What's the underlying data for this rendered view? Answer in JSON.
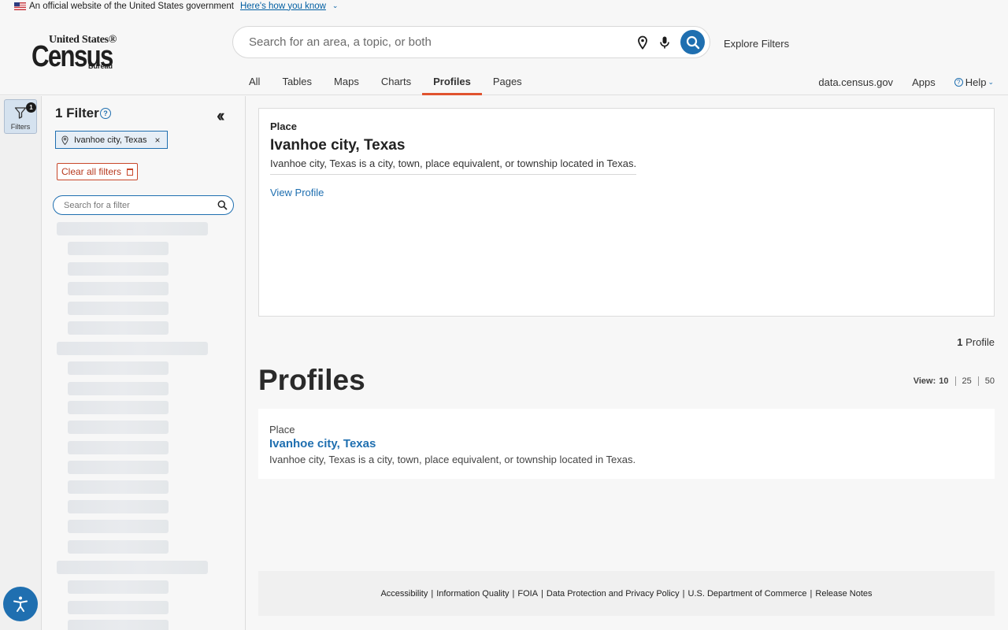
{
  "gov_banner": {
    "text": "An official website of the United States government",
    "link": "Here's how you know"
  },
  "logo": {
    "line1": "United States®",
    "line2": "Census",
    "line3": "Bureau"
  },
  "search": {
    "placeholder": "Search for an area, a topic, or both",
    "value": ""
  },
  "explore_filters": "Explore Filters",
  "tabs": [
    {
      "label": "All"
    },
    {
      "label": "Tables"
    },
    {
      "label": "Maps"
    },
    {
      "label": "Charts"
    },
    {
      "label": "Profiles",
      "active": true
    },
    {
      "label": "Pages"
    }
  ],
  "right_links": {
    "site": "data.census.gov",
    "apps": "Apps",
    "help": "Help"
  },
  "rail": {
    "filters_label": "Filters",
    "filter_count": "1"
  },
  "filter_panel": {
    "title": "1 Filter",
    "chip": "Ivanhoe city, Texas",
    "clear_all": "Clear all filters",
    "search_placeholder": "Search for a filter"
  },
  "card": {
    "type": "Place",
    "name": "Ivanhoe city, Texas",
    "description": "Ivanhoe city, Texas is a city, town, place equivalent, or township located in Texas.",
    "link": "View Profile"
  },
  "results": {
    "count": "1",
    "count_label": "Profile",
    "heading": "Profiles",
    "view_label": "View:",
    "view_options": [
      "10",
      "25",
      "50"
    ],
    "items": [
      {
        "type": "Place",
        "name": "Ivanhoe city, Texas",
        "description": "Ivanhoe city, Texas is a city, town, place equivalent, or township located in Texas."
      }
    ]
  },
  "footer": {
    "links": [
      "Accessibility",
      "Information Quality",
      "FOIA",
      "Data Protection and Privacy Policy",
      "U.S. Department of Commerce",
      "Release Notes"
    ]
  },
  "colors": {
    "accent": "#1f6fb0",
    "active_tab": "#e0532f",
    "clear": "#c8472a"
  }
}
